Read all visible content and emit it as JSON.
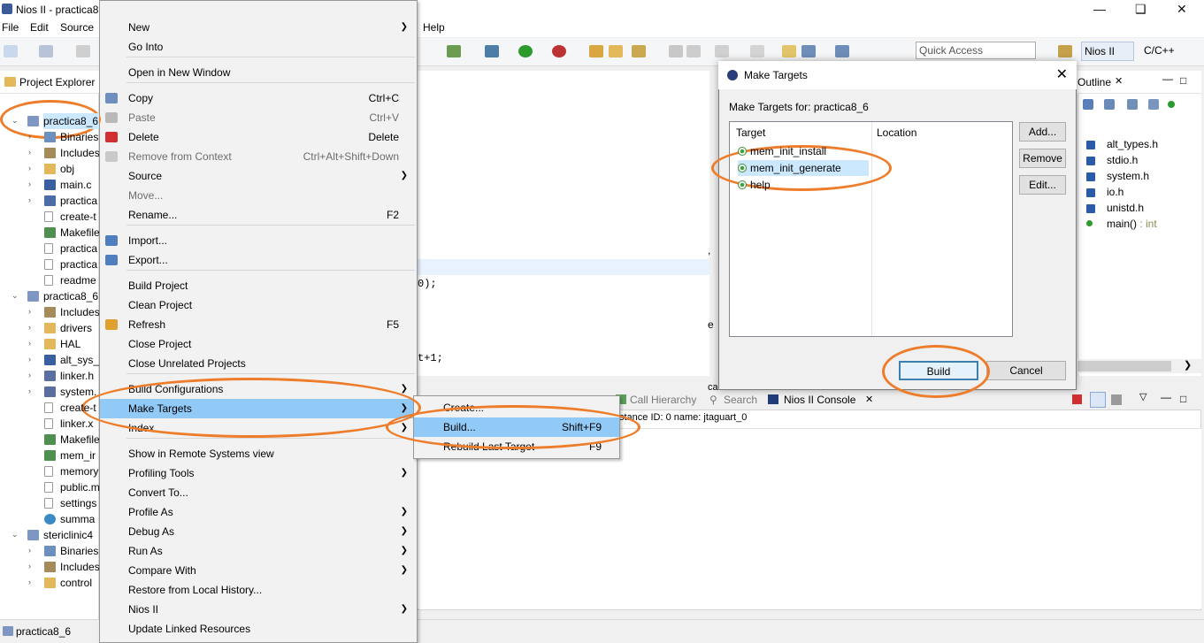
{
  "window": {
    "title": "Nios II - practica8"
  },
  "menubar": {
    "file": "File",
    "edit": "Edit",
    "source": "Source",
    "help": "Help"
  },
  "toolbar": {
    "quick_access_placeholder": "Quick Access",
    "perspective_nios": "Nios II",
    "perspective_cc": "C/C++"
  },
  "project_explorer": {
    "title": "Project Explorer",
    "rows": [
      {
        "label": "practica8_6",
        "indent": 0,
        "icon": "project-icon"
      },
      {
        "label": "Binaries",
        "indent": 1,
        "icon": "binaries-icon"
      },
      {
        "label": "Includes",
        "indent": 1,
        "icon": "includes-icon"
      },
      {
        "label": "obj",
        "indent": 1,
        "icon": "folder-icon"
      },
      {
        "label": "main.c",
        "indent": 1,
        "icon": "c-file-icon"
      },
      {
        "label": "practica",
        "indent": 1,
        "icon": "elf-icon"
      },
      {
        "label": "create-t",
        "indent": 1,
        "icon": "file-icon"
      },
      {
        "label": "Makefile",
        "indent": 1,
        "icon": "makefile-icon"
      },
      {
        "label": "practica",
        "indent": 1,
        "icon": "file-icon"
      },
      {
        "label": "practica",
        "indent": 1,
        "icon": "file-icon"
      },
      {
        "label": "readme",
        "indent": 1,
        "icon": "file-icon"
      },
      {
        "label": "practica8_6",
        "indent": 0,
        "icon": "project-icon"
      },
      {
        "label": "Includes",
        "indent": 1,
        "icon": "includes-icon"
      },
      {
        "label": "drivers",
        "indent": 1,
        "icon": "folder-icon"
      },
      {
        "label": "HAL",
        "indent": 1,
        "icon": "folder-icon"
      },
      {
        "label": "alt_sys_i",
        "indent": 1,
        "icon": "c-file-icon"
      },
      {
        "label": "linker.h",
        "indent": 1,
        "icon": "h-file-icon"
      },
      {
        "label": "system.",
        "indent": 1,
        "icon": "h-file-icon"
      },
      {
        "label": "create-t",
        "indent": 1,
        "icon": "file-icon"
      },
      {
        "label": "linker.x",
        "indent": 1,
        "icon": "file-icon"
      },
      {
        "label": "Makefile",
        "indent": 1,
        "icon": "makefile-icon"
      },
      {
        "label": "mem_ir",
        "indent": 1,
        "icon": "makefile-icon"
      },
      {
        "label": "memory",
        "indent": 1,
        "icon": "file-icon"
      },
      {
        "label": "public.m",
        "indent": 1,
        "icon": "file-icon"
      },
      {
        "label": "settings",
        "indent": 1,
        "icon": "file-icon"
      },
      {
        "label": "summa",
        "indent": 1,
        "icon": "globe-icon"
      },
      {
        "label": "stericlinic4",
        "indent": 0,
        "icon": "project-icon"
      },
      {
        "label": "Binaries",
        "indent": 1,
        "icon": "binaries-icon"
      },
      {
        "label": "Includes",
        "indent": 1,
        "icon": "includes-icon"
      },
      {
        "label": "control",
        "indent": 1,
        "icon": "folder-icon"
      }
    ]
  },
  "editor": {
    "code_line1": "0);",
    "code_line2": "t+1;",
    "frag1": ",",
    "frag2": "e"
  },
  "context_menu": {
    "items": [
      {
        "label": "New",
        "submenu": true
      },
      {
        "label": "Go Into"
      },
      {
        "label": "Open in New Window"
      },
      {
        "label": "Copy",
        "shortcut": "Ctrl+C"
      },
      {
        "label": "Paste",
        "shortcut": "Ctrl+V",
        "disabled": true
      },
      {
        "label": "Delete",
        "shortcut": "Delete"
      },
      {
        "label": "Remove from Context",
        "shortcut": "Ctrl+Alt+Shift+Down",
        "disabled": true
      },
      {
        "label": "Source",
        "submenu": true
      },
      {
        "label": "Move...",
        "disabled": true
      },
      {
        "label": "Rename...",
        "shortcut": "F2"
      },
      {
        "label": "Import..."
      },
      {
        "label": "Export..."
      },
      {
        "label": "Build Project"
      },
      {
        "label": "Clean Project"
      },
      {
        "label": "Refresh",
        "shortcut": "F5"
      },
      {
        "label": "Close Project"
      },
      {
        "label": "Close Unrelated Projects"
      },
      {
        "label": "Build Configurations",
        "submenu": true
      },
      {
        "label": "Make Targets",
        "submenu": true,
        "highlighted": true
      },
      {
        "label": "Index",
        "submenu": true
      },
      {
        "label": "Show in Remote Systems view"
      },
      {
        "label": "Profiling Tools",
        "submenu": true
      },
      {
        "label": "Convert To..."
      },
      {
        "label": "Profile As",
        "submenu": true
      },
      {
        "label": "Debug As",
        "submenu": true
      },
      {
        "label": "Run As",
        "submenu": true
      },
      {
        "label": "Compare With",
        "submenu": true
      },
      {
        "label": "Restore from Local History..."
      },
      {
        "label": "Nios II",
        "submenu": true
      },
      {
        "label": "Update Linked Resources"
      }
    ]
  },
  "submenu": {
    "items": [
      {
        "label": "Create...",
        "shortcut": ""
      },
      {
        "label": "Build...",
        "shortcut": "Shift+F9",
        "highlighted": true
      },
      {
        "label": "Rebuild Last Target",
        "shortcut": "F9"
      }
    ]
  },
  "bottom_panel": {
    "tab_call_hierarchy": "Call Hierarchy",
    "tab_search": "Search",
    "tab_console": "Nios II Console",
    "console_description": "stance ID: 0 name: jtaguart_0",
    "partial_tab": "ca"
  },
  "outline": {
    "title": "Outline",
    "items": [
      {
        "label": "alt_types.h",
        "kind": "include"
      },
      {
        "label": "stdio.h",
        "kind": "include"
      },
      {
        "label": "system.h",
        "kind": "include"
      },
      {
        "label": "io.h",
        "kind": "include"
      },
      {
        "label": "unistd.h",
        "kind": "include"
      },
      {
        "label": "main()",
        "type": " : int",
        "kind": "function"
      }
    ]
  },
  "dialog": {
    "title": "Make Targets",
    "subtitle": "Make Targets for: practica8_6",
    "col_target": "Target",
    "col_location": "Location",
    "targets": [
      "mem_init_install",
      "mem_init_generate",
      "help"
    ],
    "selected_index": 1,
    "add_label": "Add...",
    "remove_label": "Remove",
    "edit_label": "Edit...",
    "build_label": "Build",
    "cancel_label": "Cancel"
  },
  "statusbar": {
    "text": "practica8_6"
  },
  "colors": {
    "highlight": "#91c9f7",
    "annotation": "#ee7d2b",
    "dialog_selected": "#cce8ff"
  }
}
